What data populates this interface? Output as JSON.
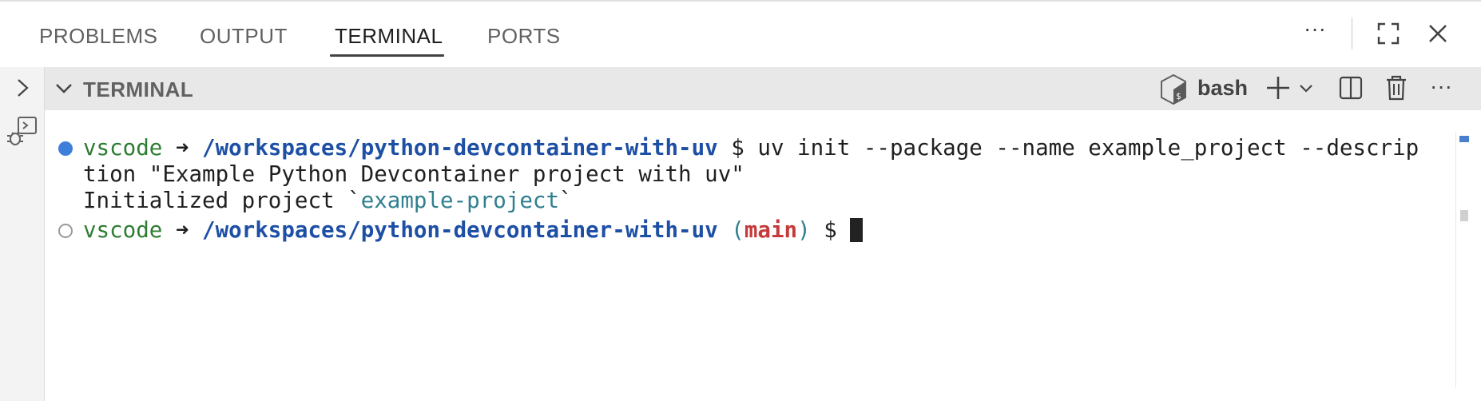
{
  "tabs": [
    {
      "label": "PROBLEMS"
    },
    {
      "label": "OUTPUT"
    },
    {
      "label": "TERMINAL",
      "active": true
    },
    {
      "label": "PORTS"
    }
  ],
  "panel_actions": {
    "more": "···",
    "icons": [
      "more-actions-icon",
      "maximize-panel-icon",
      "close-panel-icon"
    ]
  },
  "terminal_section": {
    "title": "TERMINAL",
    "shell": "bash",
    "more": "···",
    "icons": [
      "chevron-down-icon",
      "bash-shell-icon",
      "new-terminal-icon",
      "chevron-down-icon",
      "split-terminal-icon",
      "kill-terminal-icon",
      "more-actions-icon"
    ]
  },
  "terminal": {
    "line1": {
      "user": "vscode",
      "arrow": " ➜ ",
      "path": "/workspaces/python-devcontainer-with-uv",
      "prompt": " $ ",
      "command": "uv init --package --name example_project --descrip"
    },
    "line2": "tion \"Example Python Devcontainer project with uv\"",
    "line3": {
      "prefix": "Initialized project `",
      "name": "example-project",
      "suffix": "`"
    },
    "line4": {
      "user": "vscode",
      "arrow": " ➜ ",
      "path": "/workspaces/python-devcontainer-with-uv",
      "paren_open": " (",
      "branch": "main",
      "paren_close": ")",
      "prompt": " $ "
    }
  },
  "colors": {
    "accent_blue": "#3f7fdc",
    "user_green": "#2e7d32",
    "path_blue": "#1d4fa5",
    "branch_red": "#c53a3a",
    "project_teal": "#2f7f8f"
  }
}
